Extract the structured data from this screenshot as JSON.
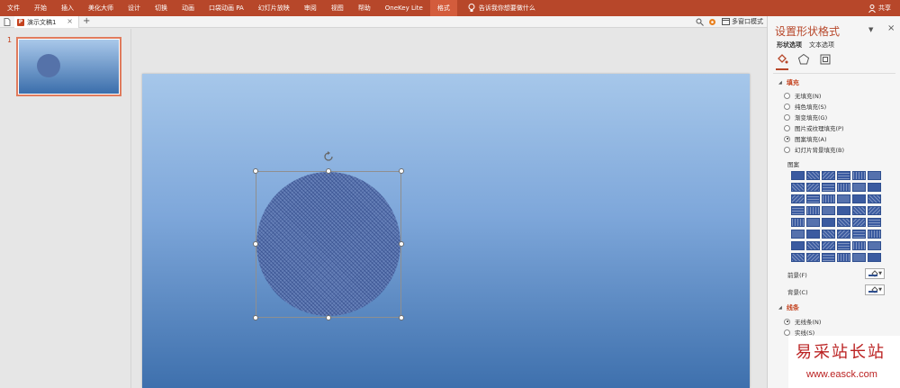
{
  "ribbon": {
    "tabs": [
      "文件",
      "开始",
      "插入",
      "美化大师",
      "设计",
      "切换",
      "动画",
      "口袋动画 PA",
      "幻灯片放映",
      "审阅",
      "视图",
      "帮助",
      "OneKey Lite",
      "格式"
    ],
    "active_tab": "格式",
    "tell_me": "告诉我你想要做什么",
    "share": "共享",
    "color": "#b7472a"
  },
  "docbar": {
    "tab_label": "演示文稿1",
    "multi_window": "多窗口模式"
  },
  "thumbnails": [
    {
      "number": "1"
    }
  ],
  "pane": {
    "title": "设置形状格式",
    "subtabs": [
      "形状选项",
      "文本选项"
    ],
    "icons": [
      "fill-line-icon",
      "effects-pentagon-icon",
      "size-properties-icon"
    ],
    "fill": {
      "header": "填充",
      "options": [
        "无填充(N)",
        "纯色填充(S)",
        "渐变填充(G)",
        "图片或纹理填充(P)",
        "图案填充(A)",
        "幻灯片背景填充(B)"
      ],
      "selected": "图案填充(A)",
      "pattern_label": "图案",
      "foreground_label": "前景(F)",
      "background_label": "背景(C)"
    },
    "line": {
      "header": "线条",
      "options": [
        "无线条(N)",
        "实线(S)"
      ],
      "selected": "无线条(N)"
    }
  },
  "watermark": {
    "text1": "易采站长站",
    "text2": "www.easck.com"
  }
}
